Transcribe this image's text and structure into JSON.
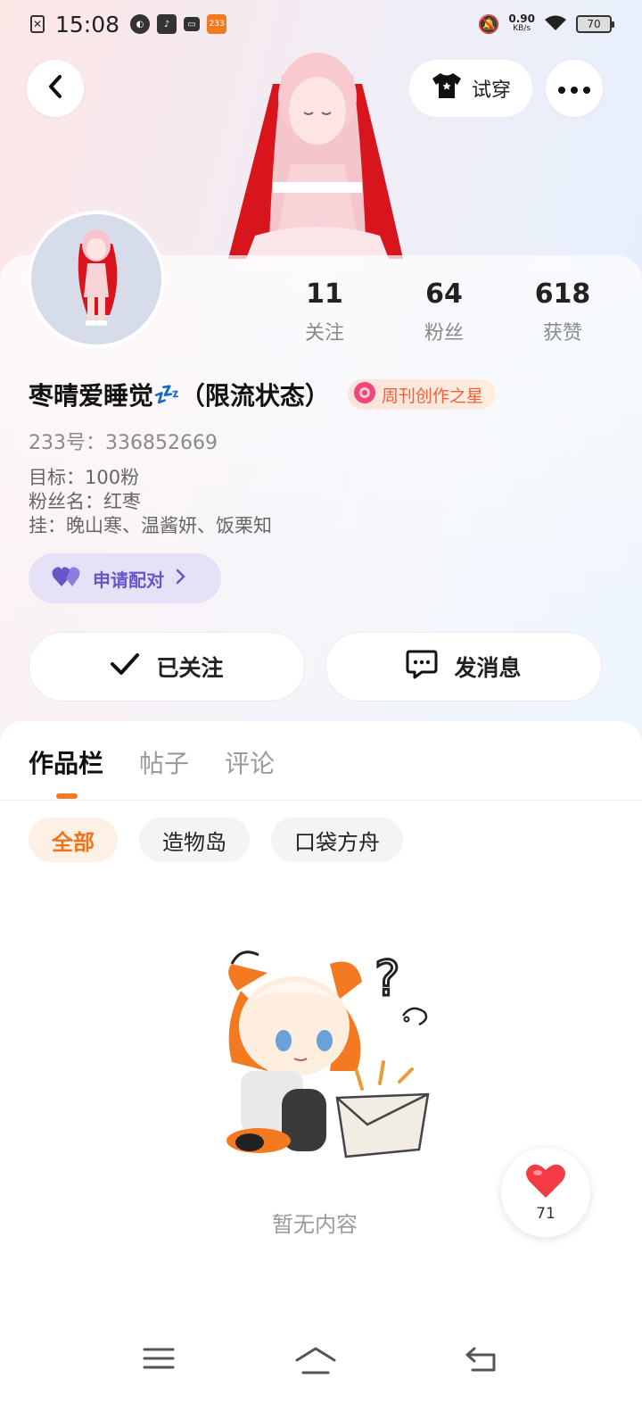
{
  "status_bar": {
    "time": "15:08",
    "net_speed_value": "0.90",
    "net_speed_unit": "KB/s",
    "battery": "70",
    "app_badge": "233"
  },
  "header": {
    "tryon_label": "试穿"
  },
  "profile": {
    "stats": [
      {
        "value": "11",
        "label": "关注"
      },
      {
        "value": "64",
        "label": "粉丝"
      },
      {
        "value": "618",
        "label": "获赞"
      }
    ],
    "name": "枣晴爱睡觉",
    "name_emoji": "💤",
    "name_suffix": "（限流状态）",
    "badge_label": "周刊创作之星",
    "uid": "233号：336852669",
    "bio_lines": [
      "目标：100粉",
      "粉丝名：红枣",
      "挂：晚山寒、温酱妍、饭栗知"
    ],
    "pair_label": "申请配对",
    "follow_label": "已关注",
    "message_label": "发消息"
  },
  "tabs": [
    {
      "label": "作品栏",
      "active": true
    },
    {
      "label": "帖子",
      "active": false
    },
    {
      "label": "评论",
      "active": false
    }
  ],
  "filters": [
    {
      "label": "全部",
      "active": true
    },
    {
      "label": "造物岛",
      "active": false
    },
    {
      "label": "口袋方舟",
      "active": false
    }
  ],
  "empty_state": {
    "text": "暂无内容"
  },
  "like_fab": {
    "count": "71"
  },
  "colors": {
    "accent_orange": "#f47a22",
    "pair_purple": "#6a55c8",
    "badge_red": "#f0603a"
  }
}
